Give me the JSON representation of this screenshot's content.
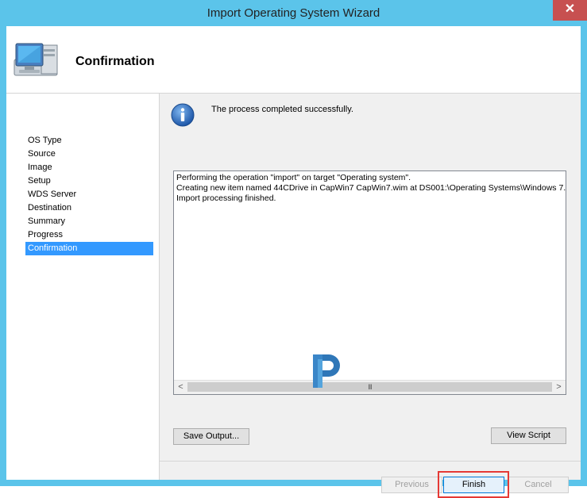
{
  "window": {
    "title": "Import Operating System Wizard",
    "close_glyph": "✕"
  },
  "header": {
    "title": "Confirmation",
    "icon": "computer-icon"
  },
  "sidebar": {
    "items": [
      {
        "label": "OS Type"
      },
      {
        "label": "Source"
      },
      {
        "label": "Image"
      },
      {
        "label": "Setup"
      },
      {
        "label": "WDS Server"
      },
      {
        "label": "Destination"
      },
      {
        "label": "Summary"
      },
      {
        "label": "Progress"
      },
      {
        "label": "Confirmation"
      }
    ],
    "active_index": 8
  },
  "content": {
    "status_message": "The process completed successfully.",
    "status_icon": "info-icon",
    "output_lines": [
      "Performing the operation \"import\" on target \"Operating system\".",
      "Creating new item named 44CDrive in CapWin7 CapWin7.wim at DS001:\\Operating Systems\\Windows 7.",
      "Import processing finished."
    ],
    "scroll_left": "<",
    "scroll_right": ">",
    "scroll_grip": "III"
  },
  "buttons": {
    "save_output": "Save Output...",
    "view_script": "View Script",
    "previous": "Previous",
    "finish": "Finish",
    "cancel": "Cancel"
  },
  "colors": {
    "titlebar": "#5bc4ea",
    "selection": "#3399ff",
    "highlight": "#e53935",
    "close": "#c75050"
  }
}
